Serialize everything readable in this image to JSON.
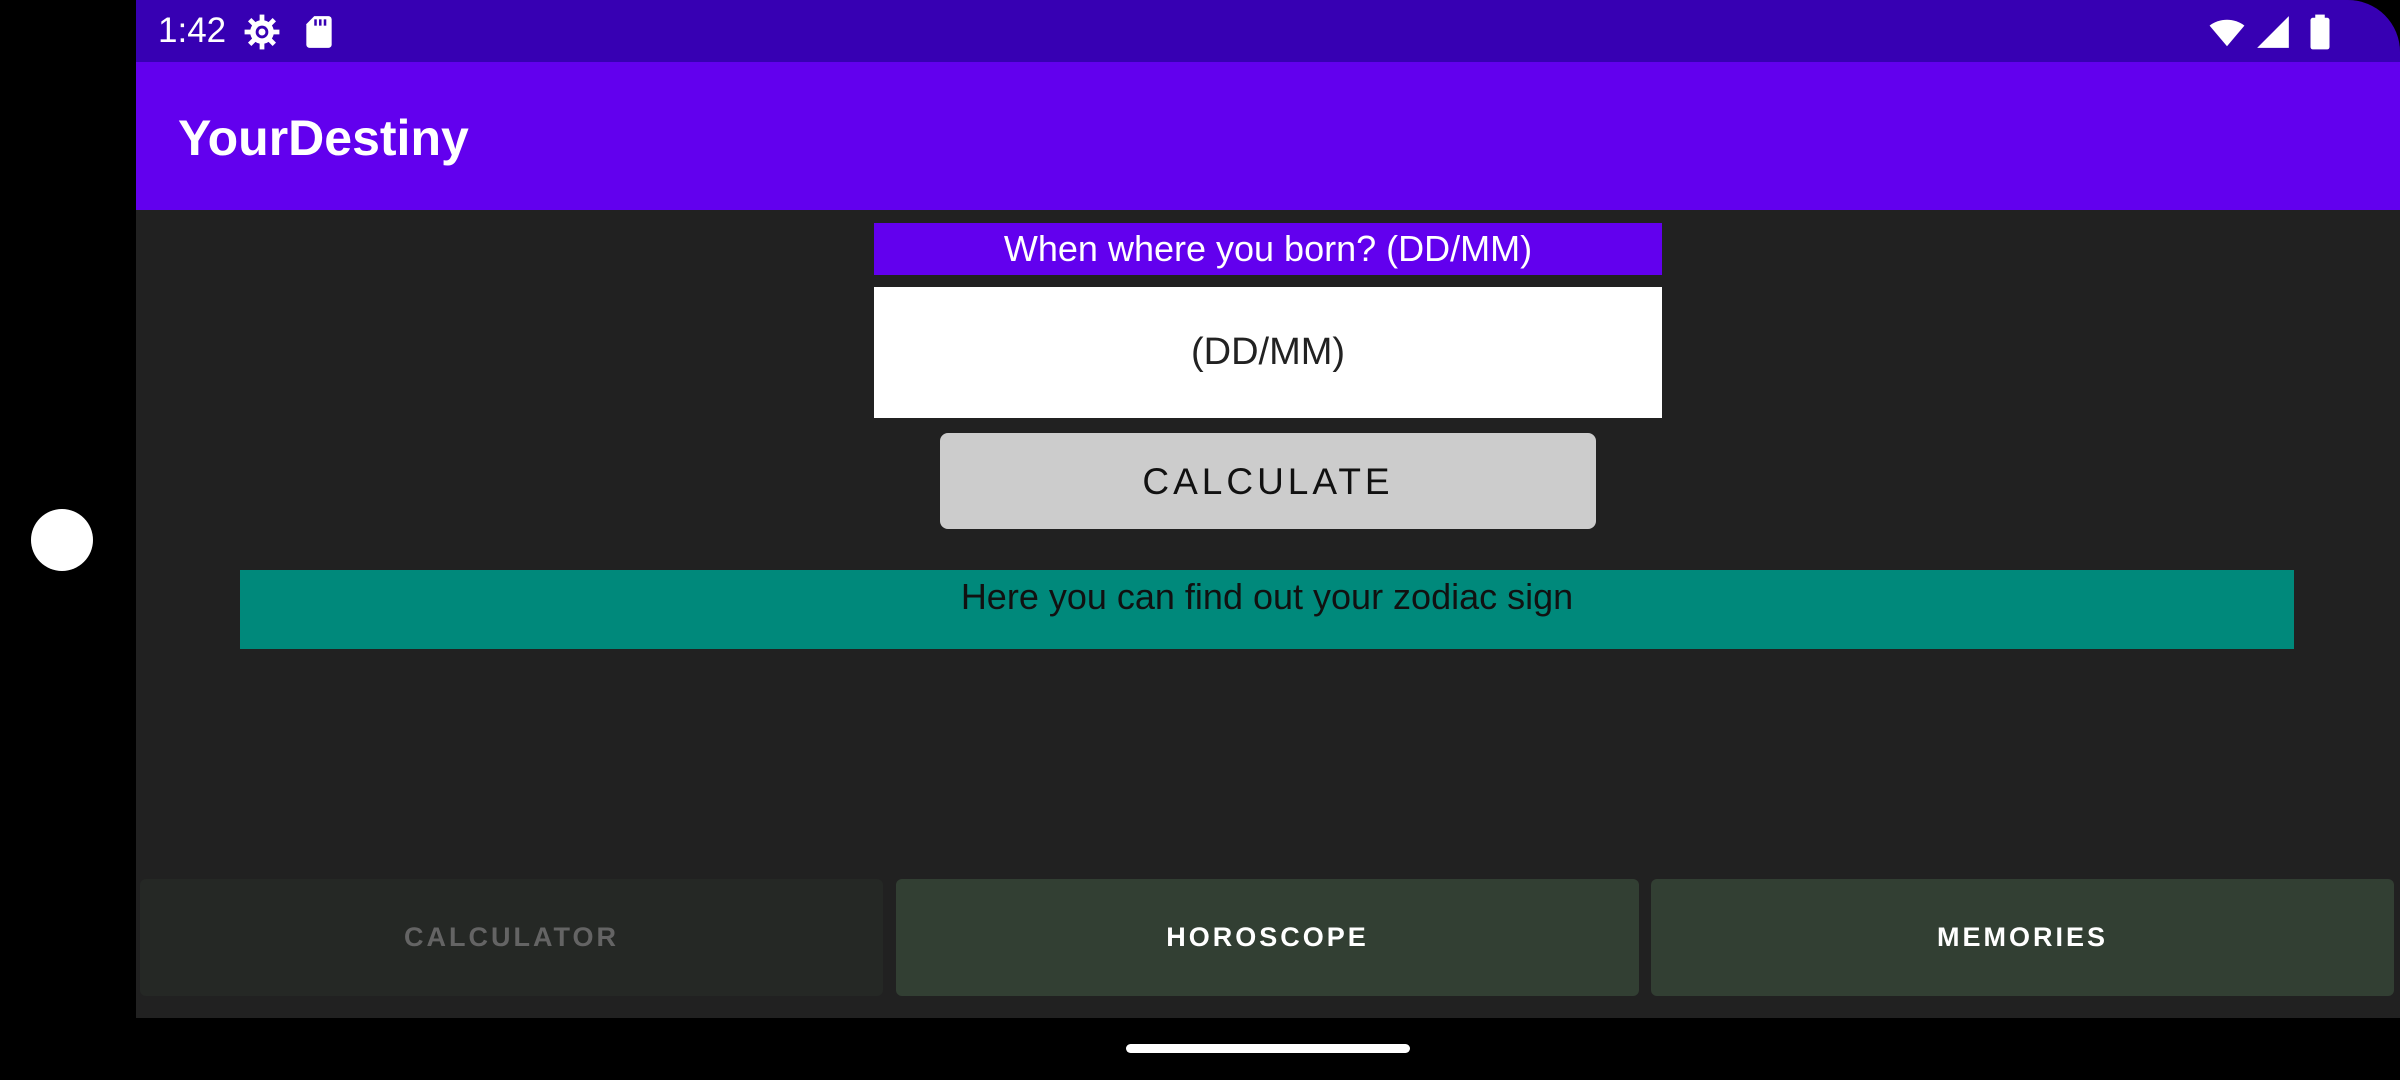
{
  "status_bar": {
    "time": "1:42",
    "icons_left": [
      "settings-gear-icon",
      "sd-card-icon"
    ],
    "icons_right": [
      "wifi-icon",
      "cell-signal-icon",
      "battery-icon"
    ],
    "background_color": "#3700b3"
  },
  "app_bar": {
    "title": "YourDestiny",
    "background_color": "#6200ee"
  },
  "form": {
    "prompt_label": "When where you born? (DD/MM)",
    "date_input": {
      "value": "",
      "placeholder": "(DD/MM)"
    },
    "calculate_button": "CALCULATE"
  },
  "result": {
    "text": "Here you can find out your zodiac sign",
    "background_color": "#00897b"
  },
  "bottom_nav": {
    "tabs": [
      {
        "label": "CALCULATOR",
        "enabled": false
      },
      {
        "label": "HOROSCOPE",
        "enabled": true
      },
      {
        "label": "MEMORIES",
        "enabled": true
      }
    ]
  }
}
